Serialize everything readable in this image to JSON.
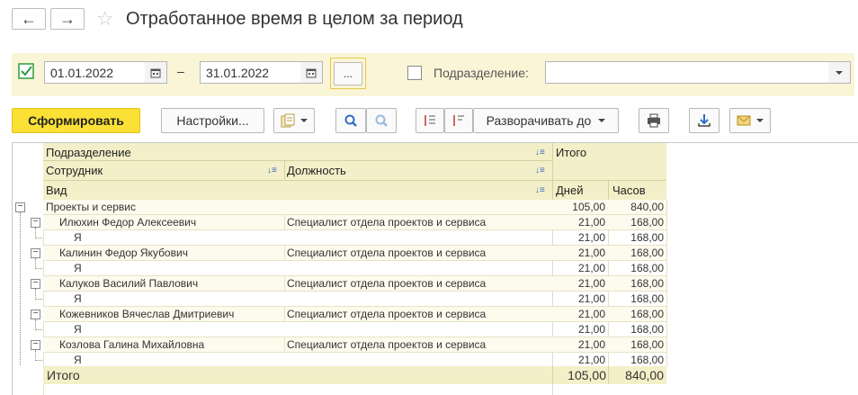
{
  "window": {
    "title": "Отработанное время в целом за период"
  },
  "filter": {
    "date_from": "01.01.2022",
    "dash": "–",
    "date_to": "31.01.2022",
    "dots": "...",
    "dept_label": "Подразделение:",
    "dept_value": ""
  },
  "toolbar": {
    "generate_label": "Сформировать",
    "settings_label": "Настройки...",
    "expand_label": "Разворачивать до"
  },
  "report": {
    "headers": {
      "department": "Подразделение",
      "employee": "Сотрудник",
      "position": "Должность",
      "kind": "Вид",
      "total": "Итого",
      "days": "Дней",
      "hours": "Часов"
    },
    "group": {
      "name": "Проекты и сервис",
      "days": "105,00",
      "hours": "840,00"
    },
    "rows": [
      {
        "employee": "Илюхин Федор Алексеевич",
        "position": "Специалист отдела проектов и сервиса",
        "days": "21,00",
        "hours": "168,00",
        "kind": "Я",
        "kind_days": "21,00",
        "kind_hours": "168,00"
      },
      {
        "employee": "Калинин Федор Якубович",
        "position": "Специалист отдела проектов и сервиса",
        "days": "21,00",
        "hours": "168,00",
        "kind": "Я",
        "kind_days": "21,00",
        "kind_hours": "168,00"
      },
      {
        "employee": "Калуков Василий Павлович",
        "position": "Специалист отдела проектов и сервиса",
        "days": "21,00",
        "hours": "168,00",
        "kind": "Я",
        "kind_days": "21,00",
        "kind_hours": "168,00"
      },
      {
        "employee": "Кожевников Вячеслав Дмитриевич",
        "position": "Специалист отдела проектов и сервиса",
        "days": "21,00",
        "hours": "168,00",
        "kind": "Я",
        "kind_days": "21,00",
        "kind_hours": "168,00"
      },
      {
        "employee": "Козлова Галина Михайловна",
        "position": "Специалист отдела проектов и сервиса",
        "days": "21,00",
        "hours": "168,00",
        "kind": "Я",
        "kind_days": "21,00",
        "kind_hours": "168,00"
      }
    ],
    "total": {
      "label": "Итого",
      "days": "105,00",
      "hours": "840,00"
    }
  },
  "colors": {
    "accent": "#fbe135",
    "header_bg": "#f3efc8",
    "filter_bg": "#fbf5d7",
    "check": "#2e9b3e"
  }
}
